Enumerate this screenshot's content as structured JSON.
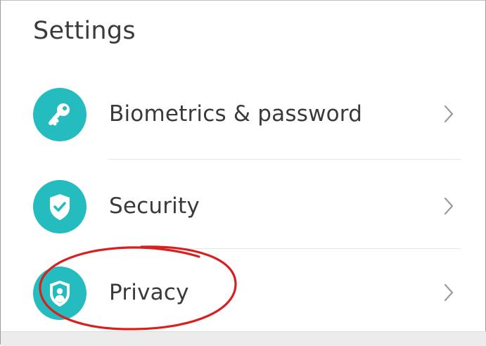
{
  "header": {
    "title": "Settings"
  },
  "settings": {
    "items": [
      {
        "label": "Biometrics & password",
        "icon": "key-icon"
      },
      {
        "label": "Security",
        "icon": "shield-check-icon"
      },
      {
        "label": "Privacy",
        "icon": "privacy-shield-icon"
      }
    ]
  },
  "colors": {
    "accent": "#25bcc0",
    "annotation": "#d8201f",
    "text": "#3a3a3a",
    "chevron": "#9a9a9a"
  }
}
